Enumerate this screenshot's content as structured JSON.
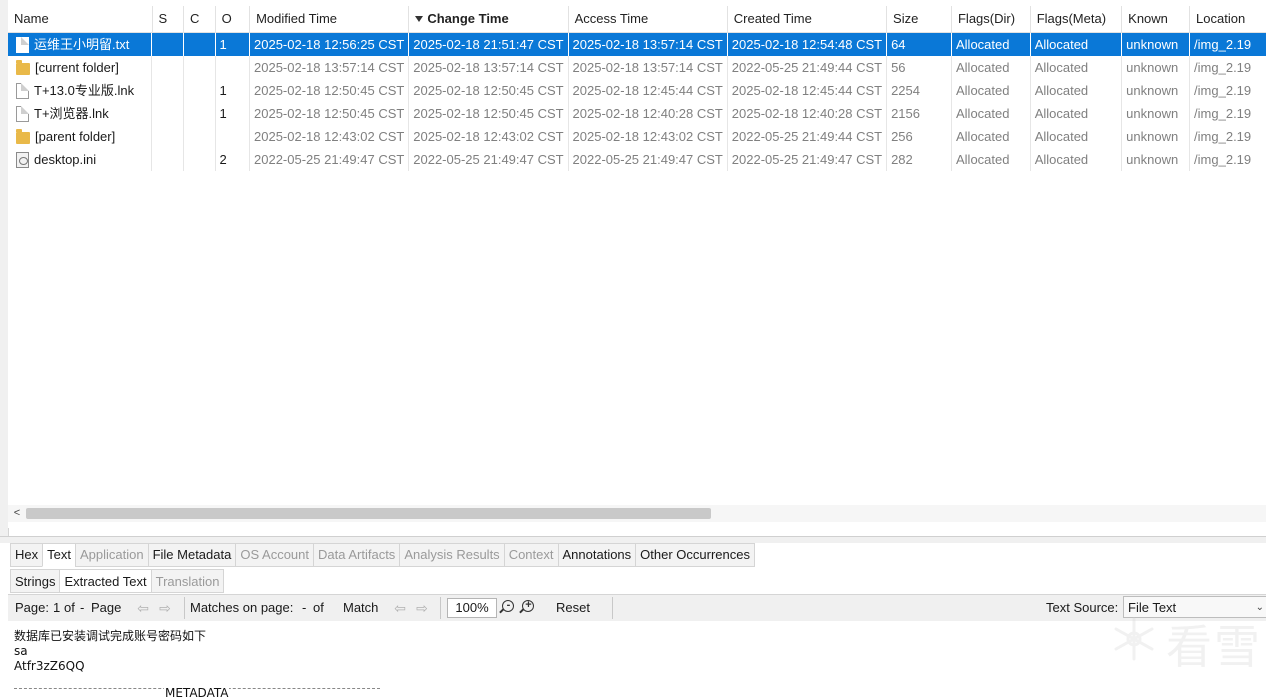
{
  "columns": [
    {
      "label": "Name"
    },
    {
      "label": "S"
    },
    {
      "label": "C"
    },
    {
      "label": "O"
    },
    {
      "label": "Modified Time"
    },
    {
      "label": "Change Time"
    },
    {
      "label": "Access Time"
    },
    {
      "label": "Created Time"
    },
    {
      "label": "Size"
    },
    {
      "label": "Flags(Dir)"
    },
    {
      "label": "Flags(Meta)"
    },
    {
      "label": "Known"
    },
    {
      "label": "Location"
    }
  ],
  "sorted_column": "Change Time",
  "rows": [
    {
      "icon": "text-file-icon",
      "name": "运维王小明留.txt",
      "s": "",
      "c": "",
      "o": "1",
      "modified": "2025-02-18 12:56:25 CST",
      "changed": "2025-02-18 21:51:47 CST",
      "accessed": "2025-02-18 13:57:14 CST",
      "created": "2025-02-18 12:54:48 CST",
      "size": "64",
      "flags_dir": "Allocated",
      "flags_meta": "Allocated",
      "known": "unknown",
      "location": "/img_2.19",
      "selected": true
    },
    {
      "icon": "folder-icon",
      "name": "[current folder]",
      "s": "",
      "c": "",
      "o": "",
      "modified": "2025-02-18 13:57:14 CST",
      "changed": "2025-02-18 13:57:14 CST",
      "accessed": "2025-02-18 13:57:14 CST",
      "created": "2022-05-25 21:49:44 CST",
      "size": "56",
      "flags_dir": "Allocated",
      "flags_meta": "Allocated",
      "known": "unknown",
      "location": "/img_2.19",
      "selected": false
    },
    {
      "icon": "shortcut-file-icon",
      "name": "T+13.0专业版.lnk",
      "s": "",
      "c": "",
      "o": "1",
      "modified": "2025-02-18 12:50:45 CST",
      "changed": "2025-02-18 12:50:45 CST",
      "accessed": "2025-02-18 12:45:44 CST",
      "created": "2025-02-18 12:45:44 CST",
      "size": "2254",
      "flags_dir": "Allocated",
      "flags_meta": "Allocated",
      "known": "unknown",
      "location": "/img_2.19",
      "selected": false
    },
    {
      "icon": "shortcut-file-icon",
      "name": "T+浏览器.lnk",
      "s": "",
      "c": "",
      "o": "1",
      "modified": "2025-02-18 12:50:45 CST",
      "changed": "2025-02-18 12:50:45 CST",
      "accessed": "2025-02-18 12:40:28 CST",
      "created": "2025-02-18 12:40:28 CST",
      "size": "2156",
      "flags_dir": "Allocated",
      "flags_meta": "Allocated",
      "known": "unknown",
      "location": "/img_2.19",
      "selected": false
    },
    {
      "icon": "folder-icon",
      "name": "[parent folder]",
      "s": "",
      "c": "",
      "o": "",
      "modified": "2025-02-18 12:43:02 CST",
      "changed": "2025-02-18 12:43:02 CST",
      "accessed": "2025-02-18 12:43:02 CST",
      "created": "2022-05-25 21:49:44 CST",
      "size": "256",
      "flags_dir": "Allocated",
      "flags_meta": "Allocated",
      "known": "unknown",
      "location": "/img_2.19",
      "selected": false
    },
    {
      "icon": "settings-file-icon",
      "name": "desktop.ini",
      "s": "",
      "c": "",
      "o": "2",
      "modified": "2022-05-25 21:49:47 CST",
      "changed": "2022-05-25 21:49:47 CST",
      "accessed": "2022-05-25 21:49:47 CST",
      "created": "2022-05-25 21:49:47 CST",
      "size": "282",
      "flags_dir": "Allocated",
      "flags_meta": "Allocated",
      "known": "unknown",
      "location": "/img_2.19",
      "selected": false
    }
  ],
  "scroll_left_arrow": "<",
  "viewer_tabs": [
    {
      "label": "Hex",
      "enabled": true,
      "active": false
    },
    {
      "label": "Text",
      "enabled": true,
      "active": true
    },
    {
      "label": "Application",
      "enabled": false,
      "active": false
    },
    {
      "label": "File Metadata",
      "enabled": true,
      "active": false
    },
    {
      "label": "OS Account",
      "enabled": false,
      "active": false
    },
    {
      "label": "Data Artifacts",
      "enabled": false,
      "active": false
    },
    {
      "label": "Analysis Results",
      "enabled": false,
      "active": false
    },
    {
      "label": "Context",
      "enabled": false,
      "active": false
    },
    {
      "label": "Annotations",
      "enabled": true,
      "active": false
    },
    {
      "label": "Other Occurrences",
      "enabled": true,
      "active": false
    }
  ],
  "text_subtabs": [
    {
      "label": "Strings",
      "enabled": true,
      "active": false
    },
    {
      "label": "Extracted Text",
      "enabled": true,
      "active": true
    },
    {
      "label": "Translation",
      "enabled": false,
      "active": false
    }
  ],
  "toolbar": {
    "page_label": "Page:",
    "page_current": "1",
    "page_of": "of",
    "page_total": "-",
    "page_word": "Page",
    "matches_label": "Matches on page:",
    "matches_current": "-",
    "matches_of": "of",
    "match_word": "Match",
    "zoom": "100%",
    "reset_label": "Reset",
    "text_source_label": "Text Source:",
    "text_source_value": "File Text"
  },
  "extracted_text": {
    "line1": "数据库已安装调试完成账号密码如下",
    "line2": "sa",
    "line3": "Atfr3zZ6QQ",
    "metadata_label": "METADATA"
  },
  "watermark_text": "看雪",
  "colors": {
    "selection": "#0a78d7",
    "disabled_text": "#9a9a9a"
  }
}
